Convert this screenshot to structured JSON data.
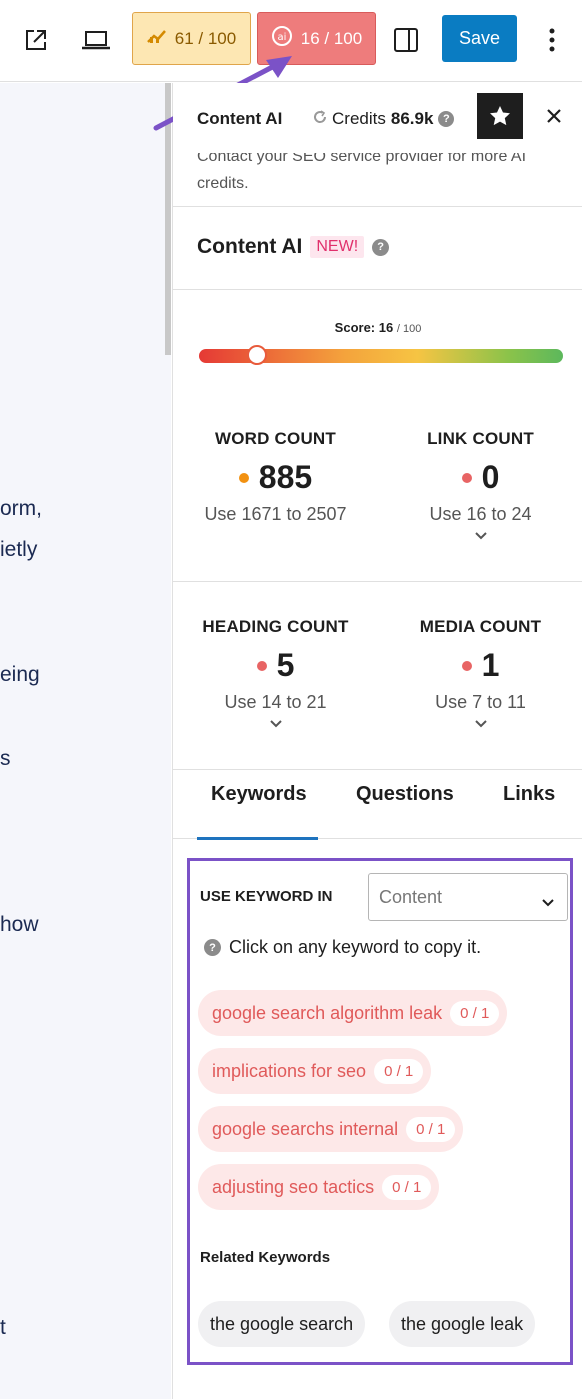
{
  "toolbar": {
    "rank_score": "61 / 100",
    "ai_score": "16 / 100",
    "save_label": "Save"
  },
  "editor": {
    "fragments": [
      "orm,",
      "ietly",
      "eing",
      "s",
      "how",
      "t"
    ]
  },
  "panel": {
    "title": "Content AI",
    "credits_label": "Credits",
    "credits_value": "86.9k",
    "notice_line1": "Contact your SEO service provider for more AI",
    "notice_line2": "credits.",
    "section_title": "Content AI",
    "new_badge": "NEW!",
    "score_label": "Score:",
    "score_value": "16",
    "score_max": "/ 100",
    "score_fraction": 0.16
  },
  "stats": {
    "word": {
      "label": "WORD COUNT",
      "value": "885",
      "hint": "Use 1671 to 2507",
      "status_color": "#f29111"
    },
    "link": {
      "label": "LINK COUNT",
      "value": "0",
      "hint": "Use 16 to 24",
      "status_color": "#e86464"
    },
    "heading": {
      "label": "HEADING COUNT",
      "value": "5",
      "hint": "Use 14 to 21",
      "status_color": "#e86464"
    },
    "media": {
      "label": "MEDIA COUNT",
      "value": "1",
      "hint": "Use 7 to 11",
      "status_color": "#e86464"
    }
  },
  "tabs": [
    "Keywords",
    "Questions",
    "Links"
  ],
  "keywords": {
    "use_in_label": "USE KEYWORD IN",
    "select_value": "Content",
    "hint": "Click on any keyword to copy it.",
    "items": [
      {
        "text": "google search algorithm leak",
        "count": "0 / 1"
      },
      {
        "text": "implications for seo",
        "count": "0 / 1"
      },
      {
        "text": "google searchs internal",
        "count": "0 / 1"
      },
      {
        "text": "adjusting seo tactics",
        "count": "0 / 1"
      }
    ],
    "related_title": "Related Keywords",
    "related": [
      "the google search",
      "the google leak"
    ]
  },
  "colors": {
    "accent": "#7b52c7",
    "save": "#0a7cc2",
    "ai_badge": "#ee7c7c",
    "rank_badge": "#fde7b3"
  }
}
